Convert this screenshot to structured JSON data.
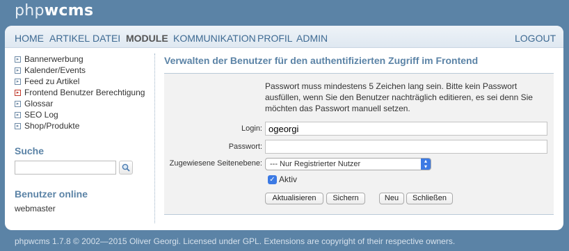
{
  "app": {
    "logo_light": "php",
    "logo_bold": "wcms"
  },
  "nav": {
    "items": [
      "HOME",
      "ARTIKEL",
      "DATEI",
      "MODULE",
      "KOMMUNIKATION",
      "PROFIL",
      "ADMIN"
    ],
    "active": "MODULE",
    "logout": "LOGOUT"
  },
  "sidebar": {
    "items": [
      "Bannerwerbung",
      "Kalender/Events",
      "Feed zu Artikel",
      "Frontend Benutzer Berechtigung",
      "Glossar",
      "SEO Log",
      "Shop/Produkte"
    ],
    "active_index": 3,
    "search_heading": "Suche",
    "search_value": "",
    "users_heading": "Benutzer online",
    "users": [
      "webmaster"
    ]
  },
  "main": {
    "title": "Verwalten der Benutzer für den authentifizierten Zugriff im Frontend",
    "info": "Passwort muss mindestens 5 Zeichen lang sein. Bitte kein Passwort ausfüllen, wenn Sie den Benutzer nachträglich editieren, es sei denn Sie möchten das Passwort manuell setzen.",
    "form": {
      "login_label": "Login:",
      "login_value": "ogeorgi",
      "password_label": "Passwort:",
      "password_value": "",
      "level_label": "Zugewiesene Seitenebene:",
      "level_value": "--- Nur Registrierter Nutzer",
      "active_label": "Aktiv",
      "active_checked": true
    },
    "buttons": {
      "update": "Aktualisieren",
      "save": "Sichern",
      "new": "Neu",
      "close": "Schließen"
    }
  },
  "footer": {
    "text": "phpwcms 1.7.8 © 2002—2015 Oliver Georgi. Licensed under GPL. Extensions are copyright of their respective owners."
  },
  "colors": {
    "background": "#5b83a6",
    "accent": "#3c7ae4",
    "heading": "#5b83a6",
    "nav_text": "#3e6a92"
  }
}
